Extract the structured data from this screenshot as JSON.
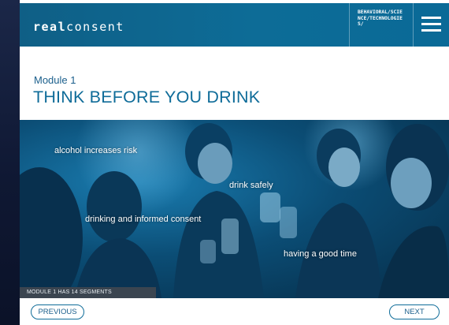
{
  "header": {
    "logo_bold": "real",
    "logo_rest": "consent",
    "brand_text": "BEHAVIORAL/SCIENCE/TECHNOLOGIES/",
    "menu_icon": "hamburger-menu-icon"
  },
  "module": {
    "label": "Module 1",
    "title": "THINK BEFORE YOU DRINK"
  },
  "hero": {
    "labels": [
      "alcohol increases risk",
      "drink safely",
      "drinking and informed consent",
      "having a good time"
    ],
    "segments_note": "MODULE 1 HAS 14 SEGMENTS"
  },
  "nav": {
    "previous_label": "PREVIOUS",
    "next_label": "NEXT"
  },
  "colors": {
    "header_blue": "#0d6c97",
    "title_blue": "#0f6c99",
    "segments_bar": "#3b4550"
  }
}
